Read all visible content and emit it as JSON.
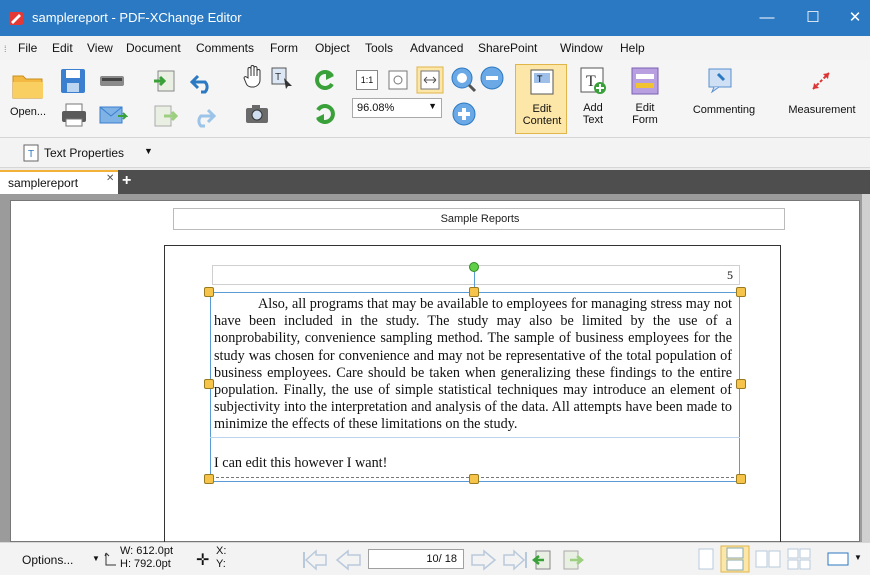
{
  "window": {
    "title": "samplereport - PDF-XChange Editor",
    "minimize_glyph": "—",
    "maximize_glyph": "☐",
    "close_glyph": "✕"
  },
  "menu": [
    "File",
    "Edit",
    "View",
    "Document",
    "Comments",
    "Form",
    "Object",
    "Tools",
    "Advanced",
    "SharePoint",
    "Window",
    "Help"
  ],
  "ribbon": {
    "open_label": "Open...",
    "zoom_value": "96.08%",
    "actual_size_label": "1:1",
    "edit_content_label_1": "Edit",
    "edit_content_label_2": "Content",
    "add_text_label_1": "Add",
    "add_text_label_2": "Text",
    "edit_form_label_1": "Edit",
    "edit_form_label_2": "Form",
    "commenting_label": "Commenting",
    "measurement_label": "Measurement"
  },
  "props_toolbar": {
    "text_properties_label": "Text Properties"
  },
  "tabs": {
    "active_tab": "samplereport"
  },
  "document": {
    "header_text": "Sample Reports",
    "page_number": "5",
    "paragraph": "Also, all programs that may be available to employees for managing stress may not have been included in the study. The study may also be limited by the use of a nonprobability, convenience sampling method. The sample of business employees for the study was chosen for convenience and may not be representative of the total population of business employees. Care should be taken when generalizing these findings to the entire population. Finally, the use of simple statistical techniques may introduce an element of subjectivity into the interpretation and analysis of the data. All attempts have been made to minimize the effects of these limitations on the study.",
    "edited_line": "I can edit this however I want!"
  },
  "status": {
    "options_label": "Options...",
    "width": "W: 612.0pt",
    "height": "H: 792.0pt",
    "x_label": "X:",
    "y_label": "Y:",
    "current_page": "10",
    "page_total": "/ 18"
  },
  "colors": {
    "titlebar": "#2b79c2",
    "accent": "#f2b23a",
    "selection": "#5b9bd5",
    "handle": "#f6c44a",
    "rotate_handle": "#5fcf47"
  }
}
